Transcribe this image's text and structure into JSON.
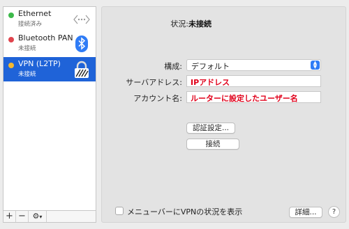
{
  "services": [
    {
      "name": "Ethernet",
      "status": "接続済み",
      "dot_color": "#3cb94a",
      "icon": "ethernet-icon",
      "selected": false
    },
    {
      "name": "Bluetooth PAN",
      "status": "未接続",
      "dot_color": "#e0444d",
      "icon": "bluetooth-icon",
      "selected": false
    },
    {
      "name": "VPN (L2TP)",
      "status": "未接続",
      "dot_color": "#f5b82e",
      "icon": "vpn-lock-icon",
      "selected": true
    }
  ],
  "bottom_bar": {
    "add": "+",
    "remove": "−",
    "gear": "⚙︎",
    "gear_chevron": "▾"
  },
  "detail": {
    "status_label": "状況:",
    "status_value": "未接続",
    "config_label": "構成:",
    "config_value": "デフォルト",
    "server_label": "サーバアドレス:",
    "server_value": "IPアドレス",
    "account_label": "アカウント名:",
    "account_value": "ルーターに設定したユーザー名",
    "auth_button": "認証設定...",
    "connect_button": "接続",
    "menubar_checkbox_label": "メニューバーにVPNの状況を表示",
    "advanced_button": "詳細...",
    "help_button": "?"
  },
  "colors": {
    "selection": "#1f63d8",
    "accent": "#2f7cf6",
    "annotation": "#e0001a"
  }
}
